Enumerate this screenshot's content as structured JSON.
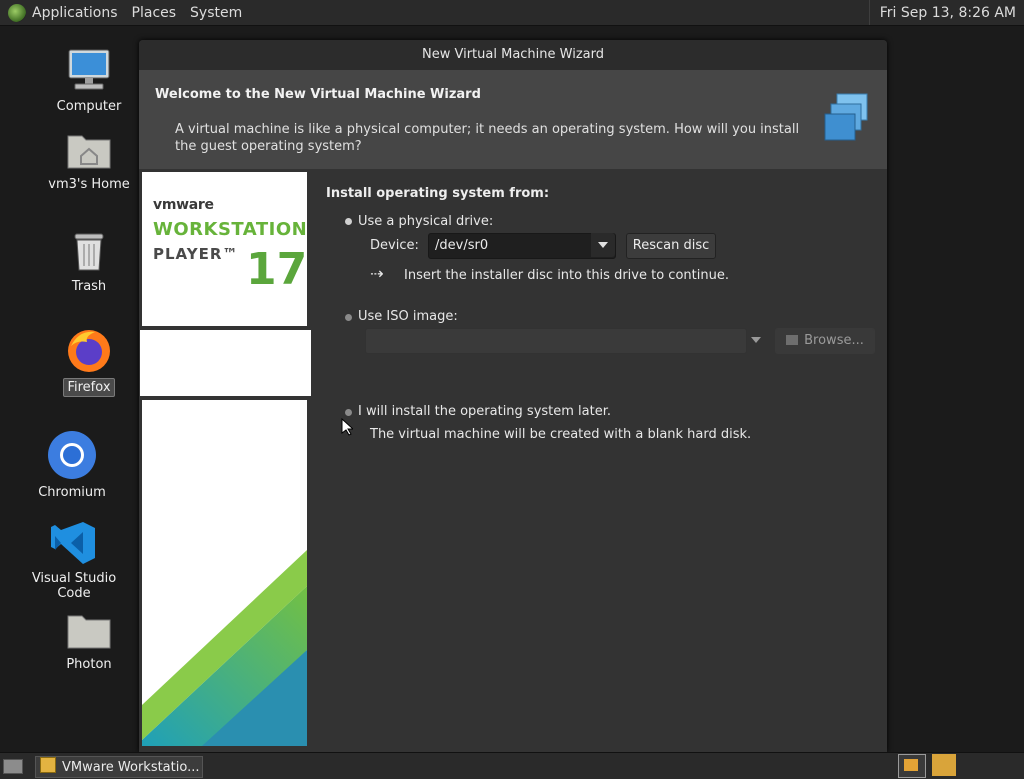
{
  "top_panel": {
    "menus": [
      "Applications",
      "Places",
      "System"
    ],
    "clock": "Fri Sep 13,  8:26 AM"
  },
  "desktop": {
    "icons": [
      {
        "label": "Computer"
      },
      {
        "label": "vm3's Home"
      },
      {
        "label": "Trash"
      },
      {
        "label": "Firefox"
      },
      {
        "label": "Chromium"
      },
      {
        "label": "Visual Studio Code"
      },
      {
        "label": "Photon"
      }
    ]
  },
  "wizard": {
    "title": "New Virtual Machine Wizard",
    "header_title": "Welcome to the New Virtual Machine Wizard",
    "header_desc": "A virtual machine is like a physical computer; it needs an operating system. How will you install the guest operating system?",
    "brand": {
      "vendor": "vmware",
      "product": "WORKSTATION",
      "edition": "PLAYER™",
      "version": "17"
    },
    "install_from_label": "Install operating system from:",
    "physical_drive": {
      "label": "Use a physical drive:",
      "device_label": "Device:",
      "device_value": "/dev/sr0",
      "rescan_label": "Rescan disc",
      "hint": "Insert the installer disc into this drive to continue."
    },
    "iso": {
      "label": "Use ISO image:",
      "value": "",
      "browse_label": "Browse..."
    },
    "later": {
      "label": "I will install the operating system later.",
      "hint": "The virtual machine will be created with a blank hard disk."
    },
    "selected_option": "physical_drive"
  },
  "taskbar": {
    "task_label": "VMware Workstatio..."
  },
  "colors": {
    "accent_green": "#67b33a",
    "window_bg": "#333333",
    "header_bg": "#464646"
  }
}
